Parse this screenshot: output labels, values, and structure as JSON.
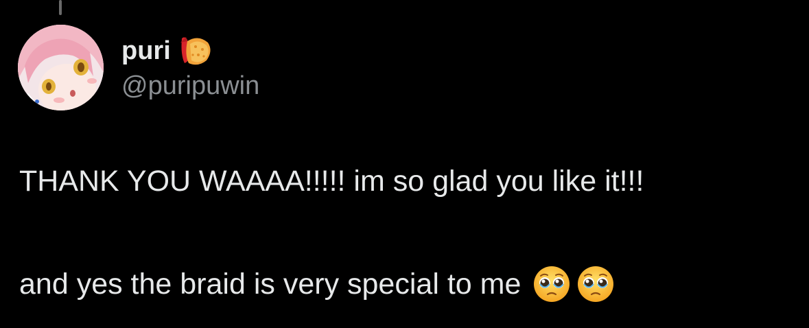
{
  "tweet": {
    "author": {
      "display_name": "puri",
      "name_emoji": "shrimp-icon",
      "handle": "@puripuwin",
      "avatar": "anime-girl-avatar"
    },
    "text_line_1": "THANK YOU WAAAA!!!!! im so glad you like it!!!",
    "text_line_2": "and yes the braid is very special to me",
    "trailing_emojis": [
      "pleading-face-icon",
      "pleading-face-icon"
    ]
  },
  "colors": {
    "background": "#000000",
    "text": "#e7e9ea",
    "secondary_text": "#8b8f93"
  }
}
